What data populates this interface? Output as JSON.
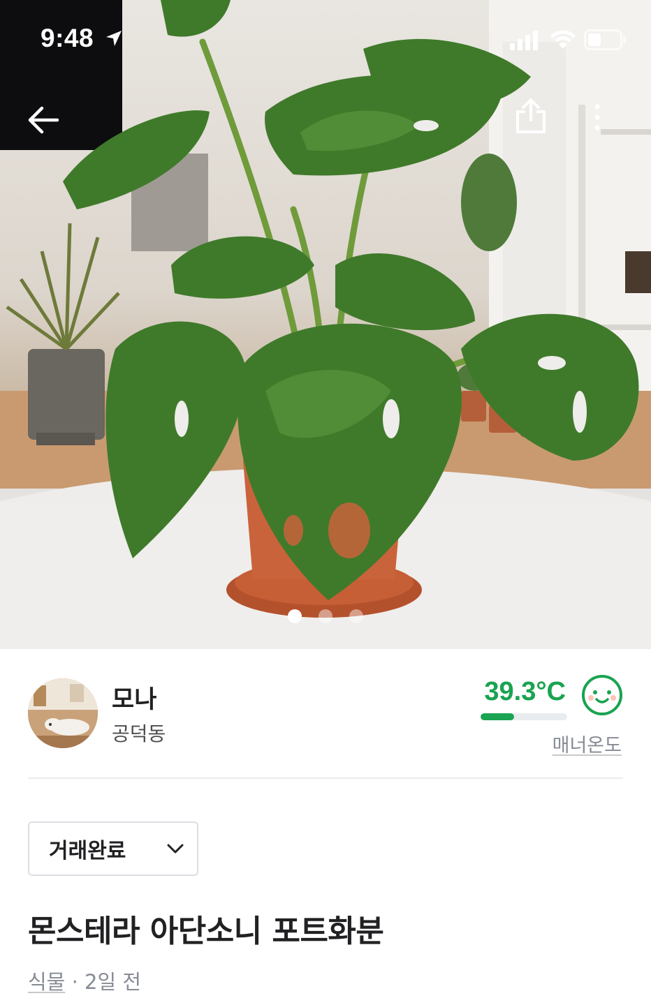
{
  "status_bar": {
    "time": "9:48"
  },
  "hero": {
    "image_description_icon": "photo-monstera-adansonii",
    "carousel": {
      "count": 3,
      "active_index": 0
    }
  },
  "seller": {
    "name": "모나",
    "location": "공덕동",
    "manner_temperature": "39.3°C",
    "manner_fill_fraction": 0.39,
    "manner_label": "매너온도",
    "manner_icon": "smiley-face-icon"
  },
  "listing": {
    "status": "거래완료",
    "title": "몬스테라 아단소니 포트화분",
    "category": "식물",
    "separator": " · ",
    "time_ago": "2일 전"
  },
  "colors": {
    "accent_green": "#1aa351",
    "text_primary": "#212124",
    "text_secondary": "#868b94"
  }
}
